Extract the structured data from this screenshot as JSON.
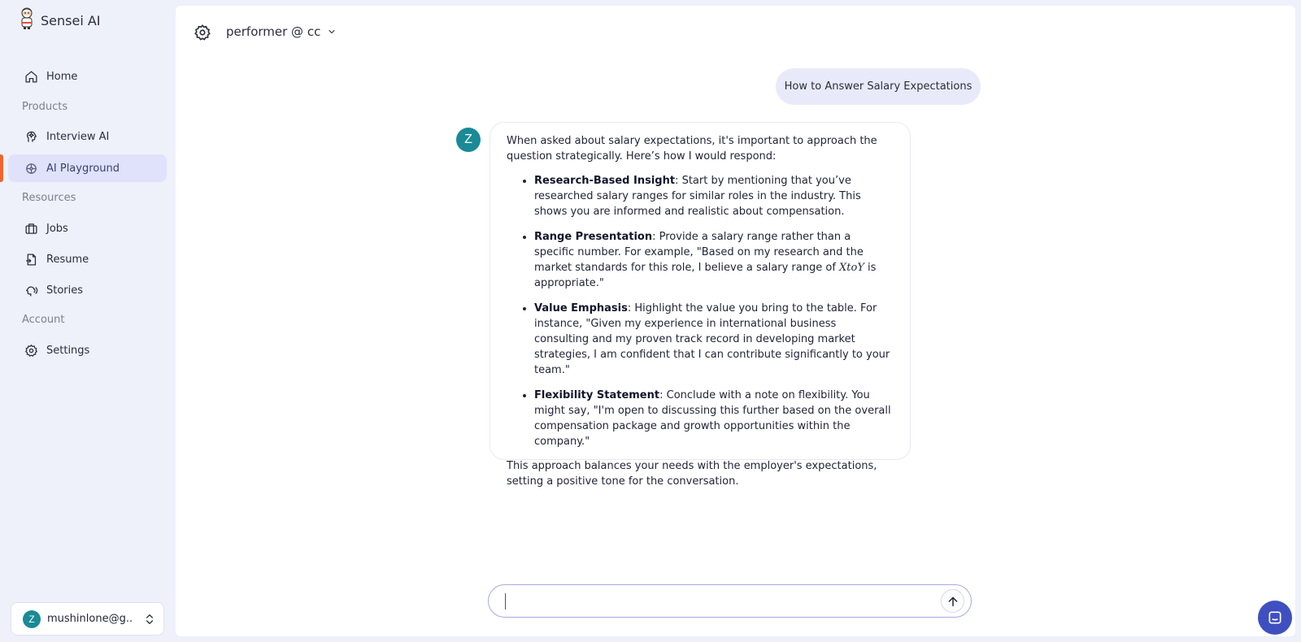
{
  "brand": {
    "name": "Sensei AI",
    "logo_icon": "sensei-mascot-icon"
  },
  "sidebar": {
    "sections": {
      "products": "Products",
      "resources": "Resources",
      "account": "Account"
    },
    "items": [
      {
        "label": "Home",
        "icon": "home-icon"
      },
      {
        "label": "Interview AI",
        "icon": "head-ai-icon"
      },
      {
        "label": "AI Playground",
        "icon": "playground-icon",
        "active": true
      },
      {
        "label": "Jobs",
        "icon": "briefcase-icon"
      },
      {
        "label": "Resume",
        "icon": "document-icon"
      },
      {
        "label": "Stories",
        "icon": "speaking-head-icon"
      },
      {
        "label": "Settings",
        "icon": "gear-icon"
      }
    ],
    "account": {
      "avatar_letter": "Z",
      "email": "mushinlone@g..."
    }
  },
  "header": {
    "model_label": "performer @ cc"
  },
  "chat": {
    "user_message": "How to Answer Salary Expectations",
    "bot_avatar_letter": "Z",
    "bot_intro": "When asked about salary expectations, it's important to approach the question strategically. Here’s how I would respond:",
    "bot_points": [
      {
        "title": "Research-Based Insight",
        "text": ": Start by mentioning that you’ve researched salary ranges for similar roles in the industry. This shows you are informed and realistic about compensation."
      },
      {
        "title": "Range Presentation",
        "text_before": ": Provide a salary range rather than a specific number. For example, \"Based on my research and the market standards for this role, I believe a salary range of ",
        "math": "XtoY",
        "text_after": " is appropriate.\""
      },
      {
        "title": "Value Emphasis",
        "text": ": Highlight the value you bring to the table. For instance, \"Given my experience in international business consulting and my proven track record in developing market strategies, I am confident that I can contribute significantly to your team.\""
      },
      {
        "title": "Flexibility Statement",
        "text": ": Conclude with a note on flexibility. You might say, \"I'm open to discussing this further based on the overall compensation package and growth opportunities within the company.\""
      }
    ],
    "bot_outro": "This approach balances your needs with the employer's expectations, setting a positive tone for the conversation.",
    "input_value": "",
    "input_placeholder": ""
  },
  "colors": {
    "accent": "#f0642f",
    "avatar": "#1a8a96",
    "active_bg": "#dfe2fa",
    "launcher": "#3f4fc0"
  }
}
